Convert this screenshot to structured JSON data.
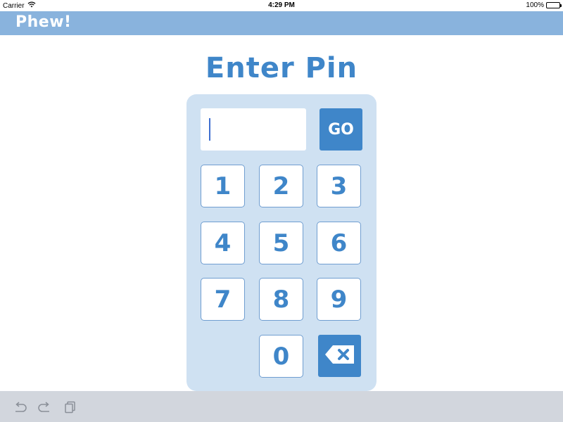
{
  "status_bar": {
    "carrier": "Carrier",
    "time": "4:29 PM",
    "battery": "100%"
  },
  "header": {
    "app_title": "Phew!"
  },
  "main": {
    "title": "Enter Pin",
    "pin_value": "",
    "go_label": "GO",
    "keys": [
      "1",
      "2",
      "3",
      "4",
      "5",
      "6",
      "7",
      "8",
      "9",
      "0"
    ],
    "backspace_icon": "backspace-x-icon"
  },
  "toolbar": {
    "icons": [
      "undo-icon",
      "redo-icon",
      "clipboard-icon"
    ]
  },
  "colors": {
    "header_bg": "#89b3dd",
    "accent": "#3f86c9",
    "panel_bg": "#cfe1f2",
    "toolbar_bg": "#d2d6dd"
  }
}
